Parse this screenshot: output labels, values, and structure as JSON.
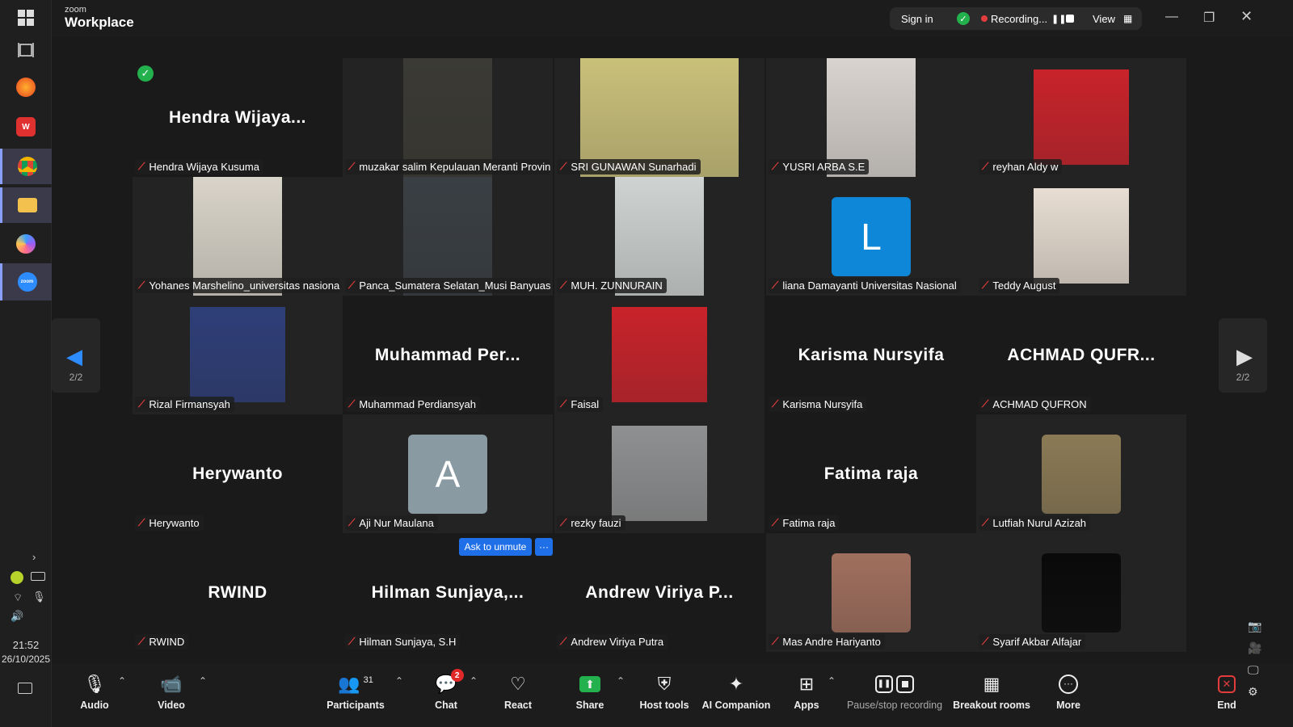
{
  "app": {
    "brand_small": "zoom",
    "brand_big": "Workplace"
  },
  "topbar": {
    "sign_in": "Sign in",
    "recording": "Recording...",
    "view": "View"
  },
  "clock": {
    "time": "21:52",
    "date": "26/10/2025"
  },
  "pager": {
    "left": "2/2",
    "right": "2/2"
  },
  "participants": [
    {
      "big": "Hendra  Wijaya...",
      "label": "Hendra Wijaya Kusuma",
      "kind": "name"
    },
    {
      "big": "",
      "label": "muzakar salim Kepulauan Meranti Provinsi ...",
      "kind": "video",
      "color": "#3b3a34"
    },
    {
      "big": "",
      "label": "SRI GUNAWAN Sunarhadi",
      "kind": "video",
      "color": "#c9c07a"
    },
    {
      "big": "",
      "label": "YUSRI ARBA S.E",
      "kind": "video",
      "color": "#d8d3cf"
    },
    {
      "big": "",
      "label": "reyhan Aldy w",
      "kind": "video",
      "color": "#c8232b"
    },
    {
      "big": "",
      "label": "Yohanes Marshelino_universitas nasional",
      "kind": "video",
      "color": "#d9d4c9"
    },
    {
      "big": "",
      "label": "Panca_Sumatera Selatan_Musi Banyuasin",
      "kind": "video",
      "color": "#3a3f44"
    },
    {
      "big": "",
      "label": "MUH. ZUNNURAIN",
      "kind": "video",
      "color": "#cfd3d2"
    },
    {
      "big": "L",
      "label": "liana Damayanti Universitas Nasional",
      "kind": "letter",
      "color": "#0e87d9"
    },
    {
      "big": "",
      "label": "Teddy August",
      "kind": "video",
      "color": "#e7ddd2"
    },
    {
      "big": "",
      "label": "Rizal Firmansyah",
      "kind": "video",
      "color": "#2e3e78"
    },
    {
      "big": "Muhammad  Per...",
      "label": "Muhammad Perdiansyah",
      "kind": "name"
    },
    {
      "big": "",
      "label": "Faisal",
      "kind": "video",
      "color": "#c8232b"
    },
    {
      "big": "Karisma Nursyifa",
      "label": "Karisma Nursyifa",
      "kind": "name"
    },
    {
      "big": "ACHMAD  QUFR...",
      "label": "ACHMAD QUFRON",
      "kind": "name"
    },
    {
      "big": "Herywanto",
      "label": "Herywanto",
      "kind": "name"
    },
    {
      "big": "A",
      "label": "Aji Nur Maulana",
      "kind": "letter",
      "color": "#8a9aa3"
    },
    {
      "big": "",
      "label": "rezky fauzi",
      "kind": "video",
      "color": "#8f9091"
    },
    {
      "big": "Fatima raja",
      "label": "Fatima raja",
      "kind": "name"
    },
    {
      "big": "",
      "label": "Lutfiah Nurul Azizah",
      "kind": "video",
      "color": "#8b7a55"
    },
    {
      "big": "RWIND",
      "label": "RWIND",
      "kind": "name"
    },
    {
      "big": "Hilman  Sunjaya,...",
      "label": "Hilman Sunjaya, S.H",
      "kind": "name"
    },
    {
      "big": "Andrew  Viriya  P...",
      "label": "Andrew Viriya Putra",
      "kind": "name"
    },
    {
      "big": "",
      "label": "Mas Andre Hariyanto",
      "kind": "video",
      "color": "#a06f5e"
    },
    {
      "big": "",
      "label": "Syarif Akbar Alfajar",
      "kind": "video",
      "color": "#0a0a0a"
    }
  ],
  "ask_unmute": {
    "label": "Ask to unmute",
    "more": "···"
  },
  "toolbar": {
    "audio": "Audio",
    "video": "Video",
    "participants": "Participants",
    "participants_count": "31",
    "chat": "Chat",
    "chat_badge": "2",
    "react": "React",
    "share": "Share",
    "host_tools": "Host tools",
    "ai_companion": "AI Companion",
    "apps": "Apps",
    "pause_recording": "Pause/stop recording",
    "breakout": "Breakout rooms",
    "more": "More",
    "end": "End"
  }
}
